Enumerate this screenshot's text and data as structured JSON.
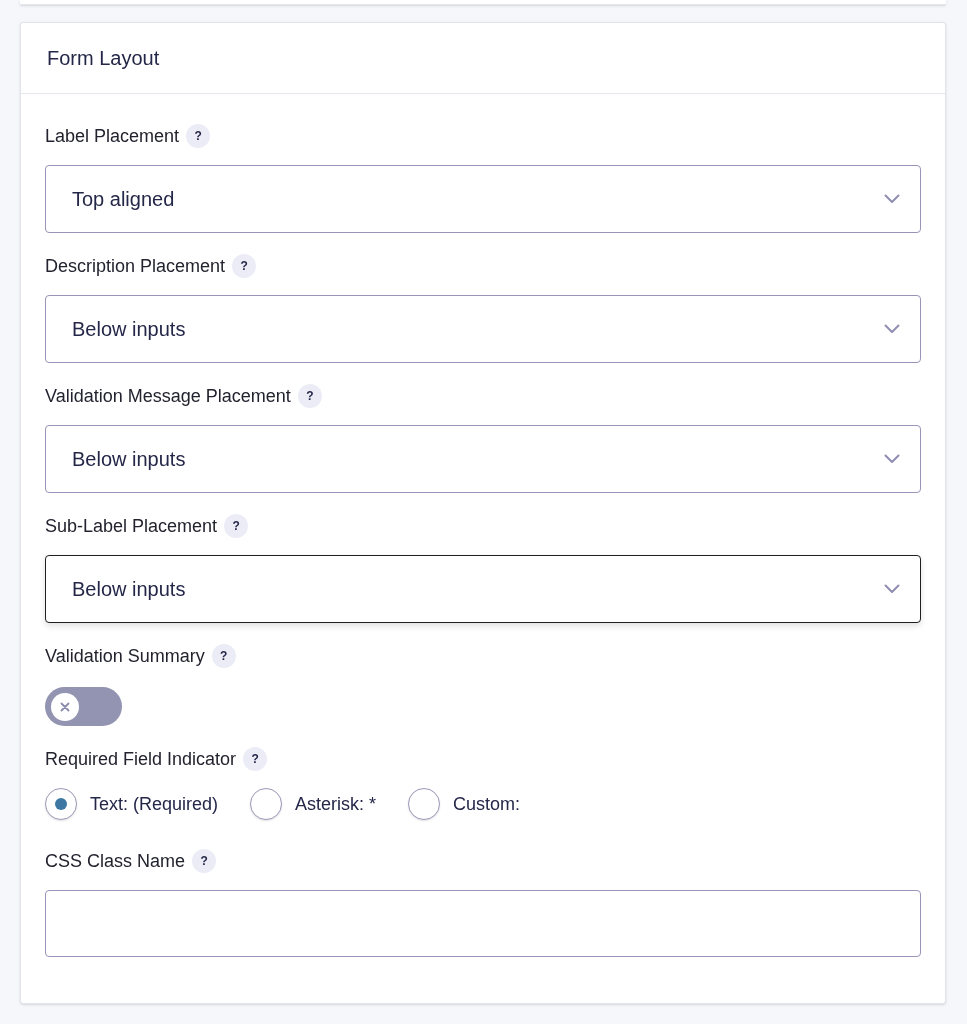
{
  "panel": {
    "title": "Form Layout"
  },
  "fields": [
    {
      "kind": "select",
      "label": "Label Placement",
      "help": "?",
      "value": "Top aligned",
      "focused": false
    },
    {
      "kind": "select",
      "label": "Description Placement",
      "help": "?",
      "value": "Below inputs",
      "focused": false
    },
    {
      "kind": "select",
      "label": "Validation Message Placement",
      "help": "?",
      "value": "Below inputs",
      "focused": false
    },
    {
      "kind": "select",
      "label": "Sub-Label Placement",
      "help": "?",
      "value": "Below inputs",
      "focused": true
    },
    {
      "kind": "toggle",
      "label": "Validation Summary",
      "help": "?",
      "on": false
    },
    {
      "kind": "radio",
      "label": "Required Field Indicator",
      "help": "?",
      "options": [
        {
          "label": "Text: (Required)",
          "selected": true
        },
        {
          "label": "Asterisk: *",
          "selected": false
        },
        {
          "label": "Custom:",
          "selected": false
        }
      ]
    },
    {
      "kind": "text",
      "label": "CSS Class Name",
      "help": "?"
    }
  ]
}
